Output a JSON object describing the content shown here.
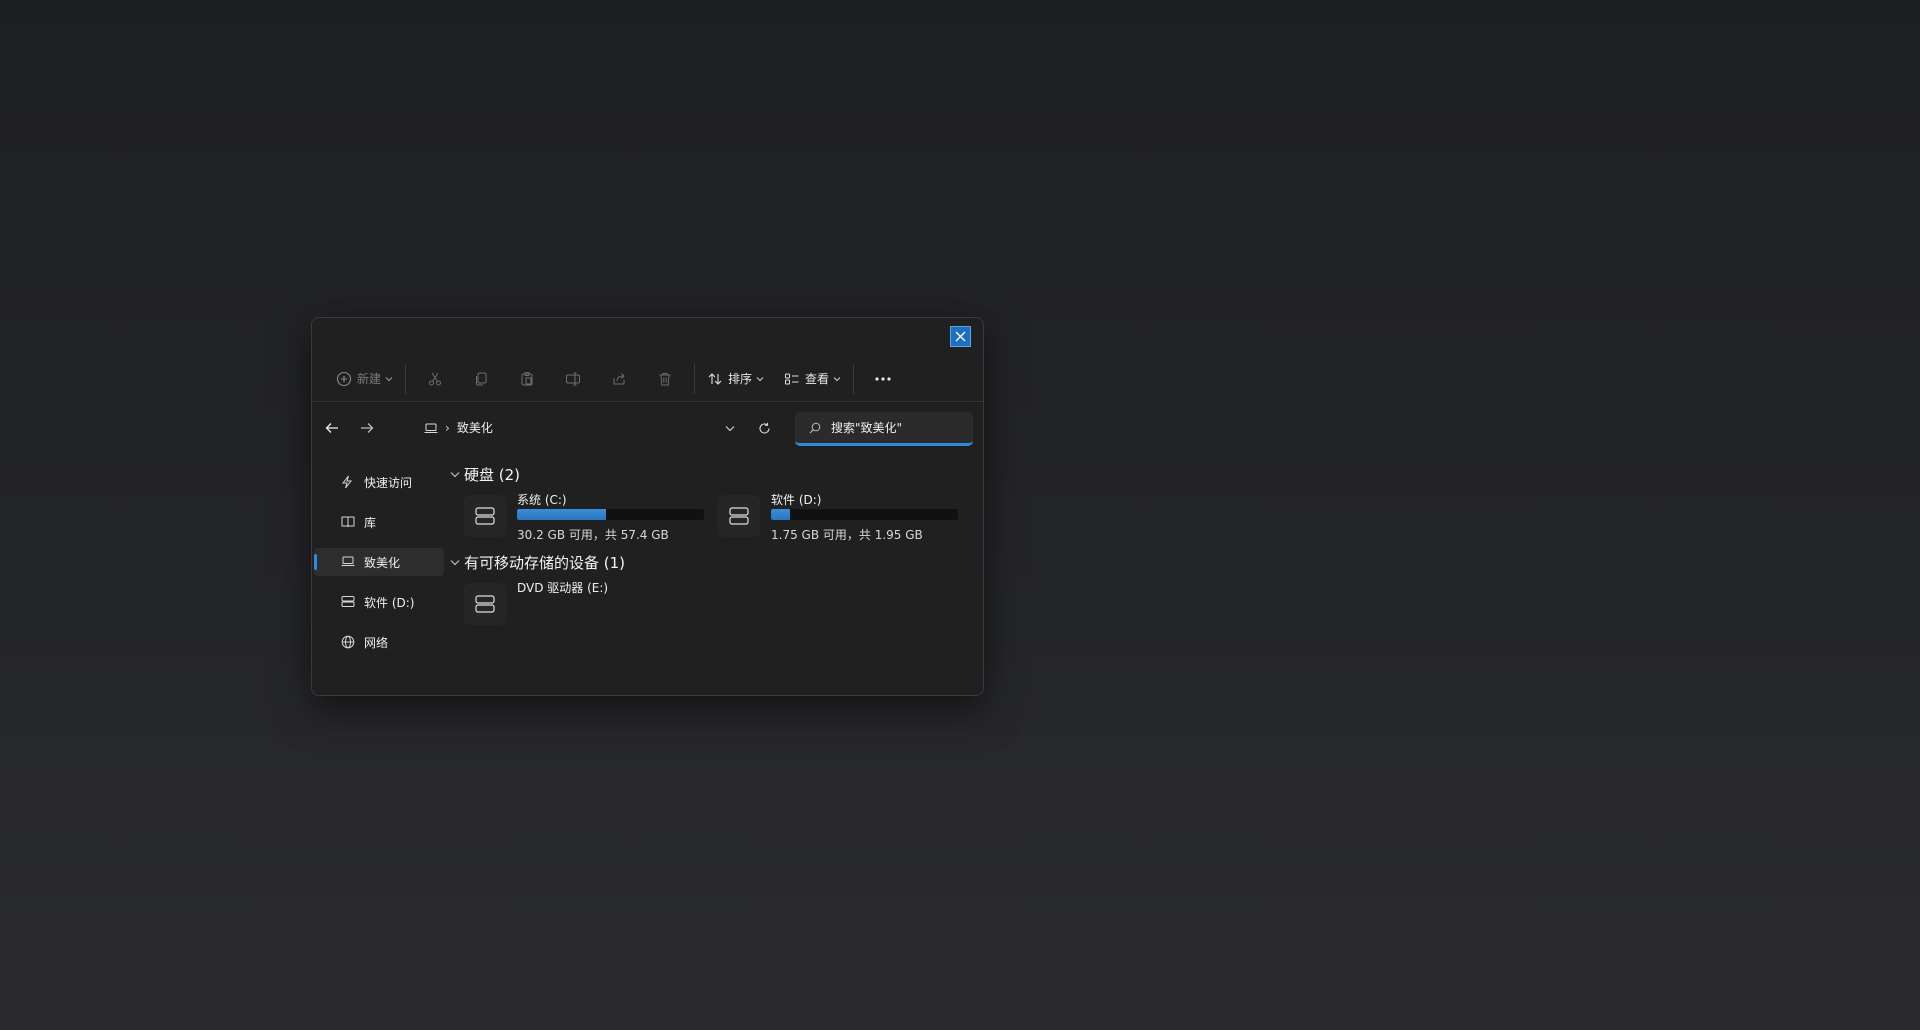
{
  "window": {
    "toolbar": {
      "new_label": "新建",
      "sort_label": "排序",
      "view_label": "查看"
    },
    "address": {
      "location": "致美化",
      "search_placeholder": "搜索\"致美化\""
    },
    "sidebar": {
      "items": [
        {
          "label": "快速访问",
          "icon": "quick-access-icon"
        },
        {
          "label": "库",
          "icon": "library-icon"
        },
        {
          "label": "致美化",
          "icon": "computer-icon",
          "active": true
        },
        {
          "label": "软件 (D:)",
          "icon": "drive-icon"
        },
        {
          "label": "网络",
          "icon": "network-icon"
        }
      ]
    },
    "groups": {
      "hard_disks": {
        "title": "硬盘 (2)",
        "drives": [
          {
            "name": "系统 (C:)",
            "info": "30.2 GB 可用，共 57.4 GB",
            "used_fraction": 0.474
          },
          {
            "name": "软件 (D:)",
            "info": "1.75 GB 可用，共 1.95 GB",
            "used_fraction": 0.103
          }
        ]
      },
      "removable": {
        "title": "有可移动存储的设备 (1)",
        "drives": [
          {
            "name": "DVD 驱动器 (E:)"
          }
        ]
      }
    },
    "colors": {
      "accent": "#2d8ae0",
      "close_button": "#1f6fc0",
      "window_bg": "#202020"
    }
  }
}
